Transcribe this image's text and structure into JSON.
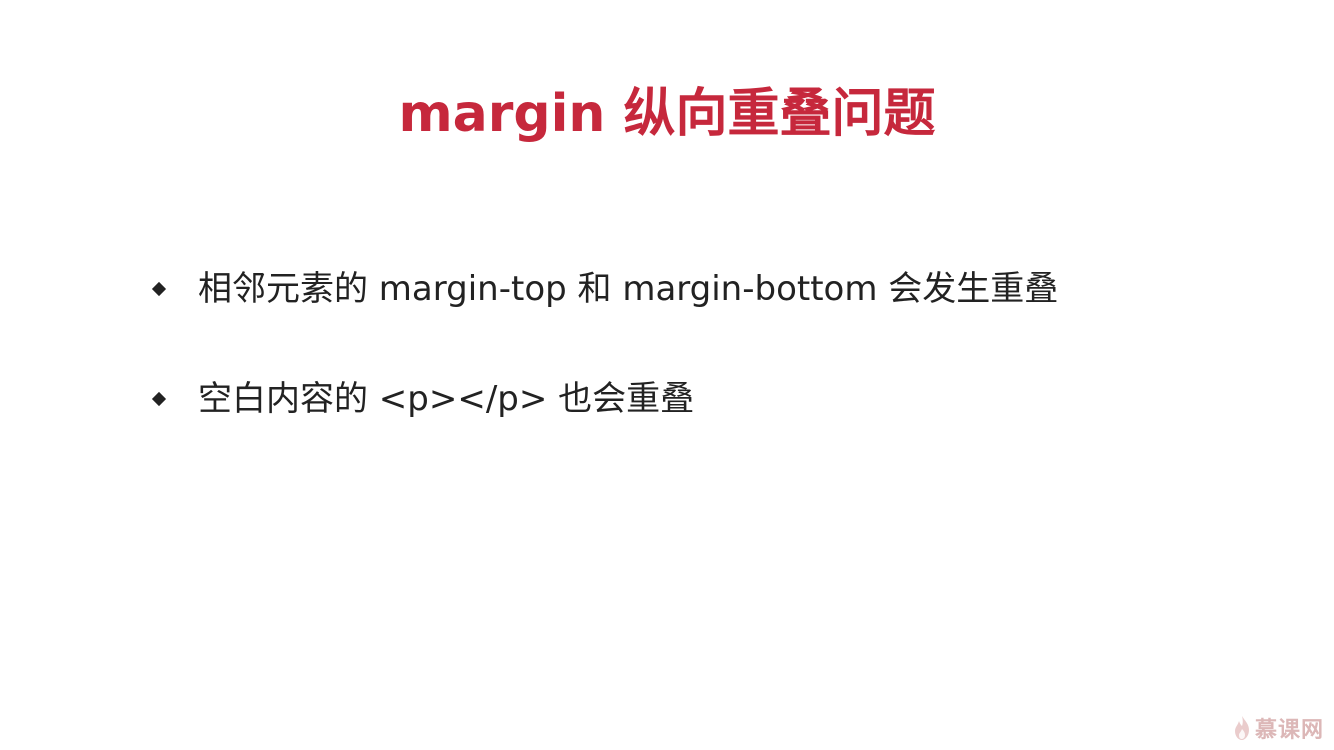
{
  "slide": {
    "title": "margin 纵向重叠问题",
    "bullets": [
      "相邻元素的 margin-top 和 margin-bottom 会发生重叠",
      "空白内容的 <p></p> 也会重叠"
    ],
    "watermark": "慕课网"
  },
  "colors": {
    "title": "#c6283c",
    "text": "#222222",
    "watermark": "#d9b0b0"
  },
  "icons": {
    "bullet": "diamond-bullet-icon",
    "logo": "flame-icon"
  }
}
